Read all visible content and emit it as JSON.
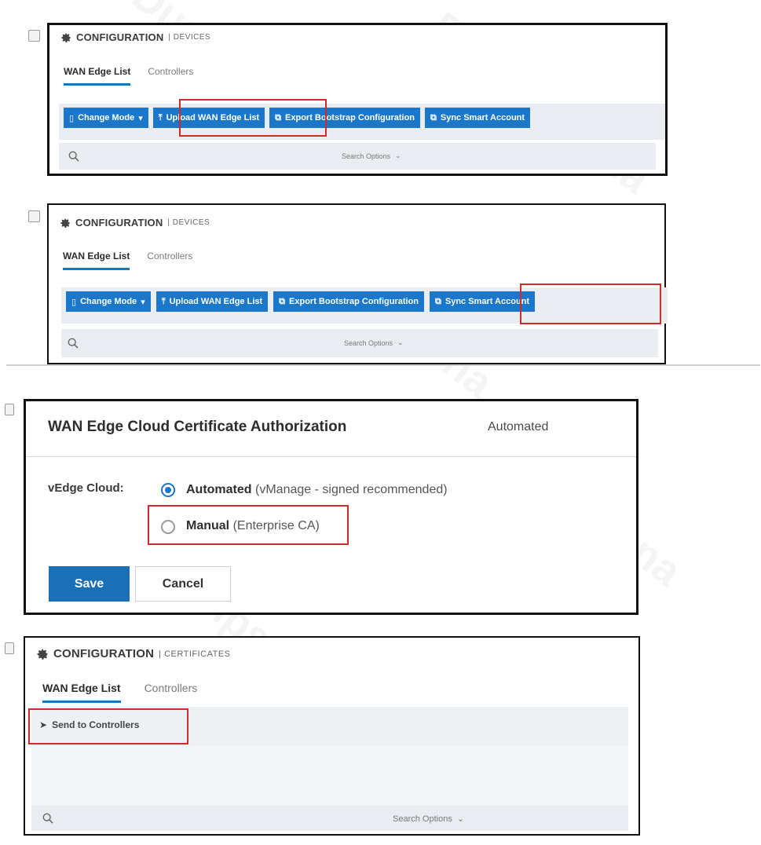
{
  "watermark": "DumpsArena",
  "devices_panel_a": {
    "title": "CONFIGURATION",
    "subtitle": "DEVICES",
    "tabs": [
      "WAN Edge List",
      "Controllers"
    ],
    "buttons": [
      "Change Mode",
      "Upload WAN Edge List",
      "Export Bootstrap Configuration",
      "Sync Smart Account"
    ],
    "search_options": "Search Options",
    "highlighted": "Upload WAN Edge List"
  },
  "devices_panel_b": {
    "title": "CONFIGURATION",
    "subtitle": "DEVICES",
    "tabs": [
      "WAN Edge List",
      "Controllers"
    ],
    "buttons": [
      "Change Mode",
      "Upload WAN Edge List",
      "Export Bootstrap Configuration",
      "Sync Smart Account"
    ],
    "search_options": "Search Options",
    "highlighted": "Sync Smart Account"
  },
  "cert_panel": {
    "title": "WAN Edge Cloud Certificate Authorization",
    "mode": "Automated",
    "field_label": "vEdge Cloud:",
    "options": [
      {
        "name": "Automated",
        "detail": "(vManage - signed recommended)",
        "selected": true
      },
      {
        "name": "Manual",
        "detail": "(Enterprise CA)",
        "selected": false
      }
    ],
    "save_label": "Save",
    "cancel_label": "Cancel"
  },
  "certificates_panel": {
    "title": "CONFIGURATION",
    "subtitle": "CERTIFICATES",
    "tabs": [
      "WAN Edge List",
      "Controllers"
    ],
    "action": "Send to Controllers",
    "search_options": "Search Options"
  },
  "colors": {
    "primary": "#1a77c9",
    "highlight": "#d02a2a",
    "frame": "#111111"
  }
}
